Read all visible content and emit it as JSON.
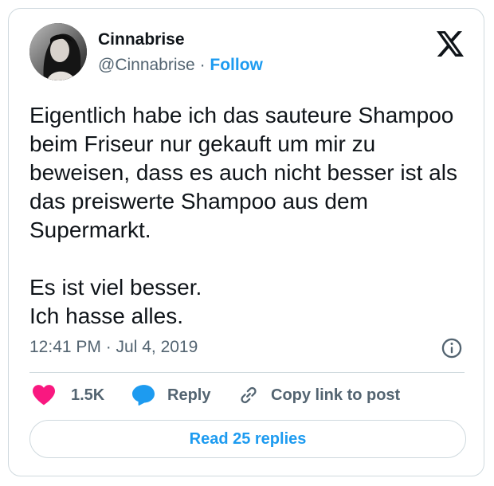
{
  "author": {
    "display_name": "Cinnabrise",
    "handle": "@Cinnabrise",
    "separator": "·",
    "follow_label": "Follow"
  },
  "brand": {
    "icon": "x-logo-icon"
  },
  "tweet": {
    "paragraph_1": "Eigentlich habe ich das sauteure Shampoo beim Friseur nur gekauft um mir zu beweisen, dass es auch nicht besser ist als das preiswerte Shampoo aus dem Supermarkt.",
    "line_2": "Es ist viel besser.",
    "line_3": "Ich hasse alles.",
    "timestamp": "12:41 PM · Jul 4, 2019"
  },
  "actions": {
    "like_count": "1.5K",
    "reply_label": "Reply",
    "copy_label": "Copy link to post"
  },
  "footer": {
    "read_replies_label": "Read 25 replies"
  },
  "colors": {
    "accent": "#1d9bf0",
    "like": "#f91880",
    "muted": "#536471",
    "text": "#0f1419",
    "border": "#cfd9de"
  }
}
